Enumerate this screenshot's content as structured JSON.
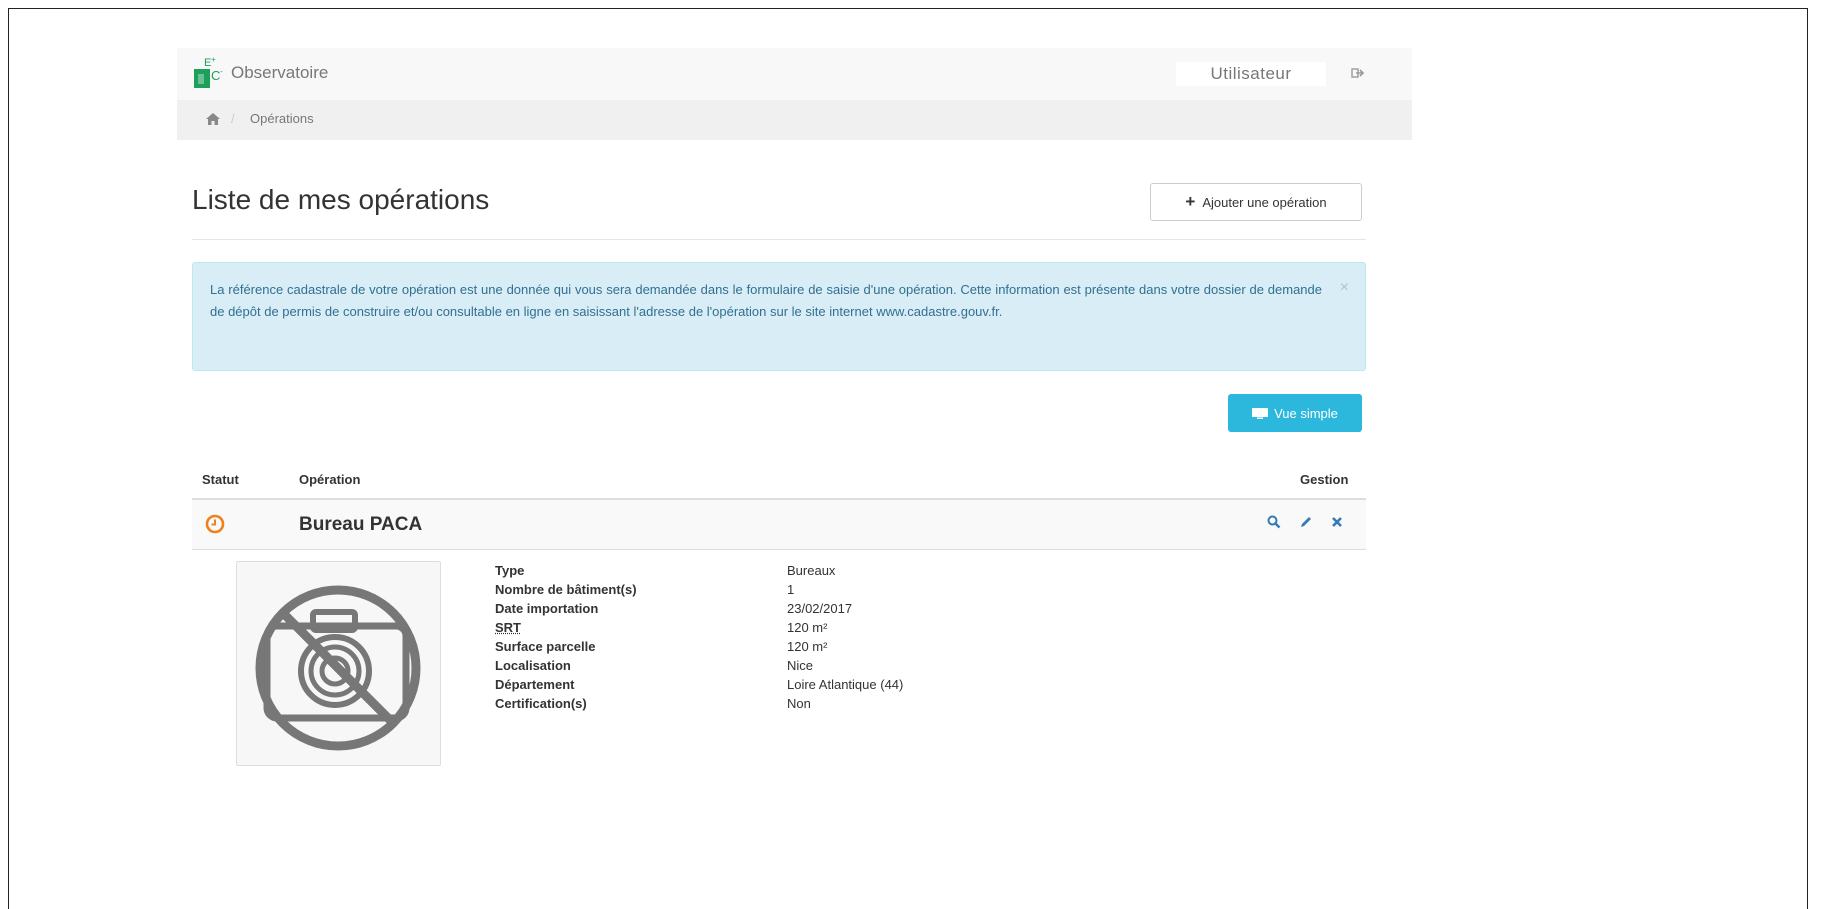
{
  "header": {
    "brand": "Observatoire",
    "user": "Utilisateur",
    "logo_icon": "ec-logo",
    "logout_icon": "logout-icon"
  },
  "breadcrumb": {
    "home_icon": "home-icon",
    "separator": "/",
    "current": "Opérations"
  },
  "main": {
    "title": "Liste de mes opérations",
    "add_button": "Ajouter une opération",
    "alert_text": "La référence cadastrale de votre opération est une donnée qui vous sera demandée dans le formulaire de saisie d'une opération. Cette information est présente dans votre dossier de demande de dépôt de permis de construire et/ou consultable en ligne en saisissant l'adresse de l'opération sur le site internet www.cadastre.gouv.fr.",
    "alert_close": "×",
    "view_button": "Vue simple"
  },
  "table": {
    "headers": {
      "status": "Statut",
      "operation": "Opération",
      "gestion": "Gestion"
    },
    "rows": [
      {
        "name": "Bureau PACA",
        "status_icon": "clock-icon",
        "status_color": "#f0821e",
        "actions": [
          "search-icon",
          "pencil-icon",
          "delete-icon"
        ],
        "details": [
          {
            "label": "Type",
            "value": "Bureaux"
          },
          {
            "label": "Nombre de bâtiment(s)",
            "value": "1"
          },
          {
            "label": "Date importation",
            "value": "23/02/2017"
          },
          {
            "label": "SRT",
            "value": "120 m²"
          },
          {
            "label": "Surface parcelle",
            "value": "120 m²"
          },
          {
            "label": "Localisation",
            "value": "Nice"
          },
          {
            "label": "Département",
            "value": "Loire Atlantique (44)"
          },
          {
            "label": "Certification(s)",
            "value": "Non"
          }
        ]
      }
    ]
  },
  "colors": {
    "brand_green": "#1ca05a",
    "info_bg": "#d9edf7",
    "info_text": "#31708f",
    "button_blue": "#2cb7dc",
    "action_blue": "#337ab7"
  }
}
